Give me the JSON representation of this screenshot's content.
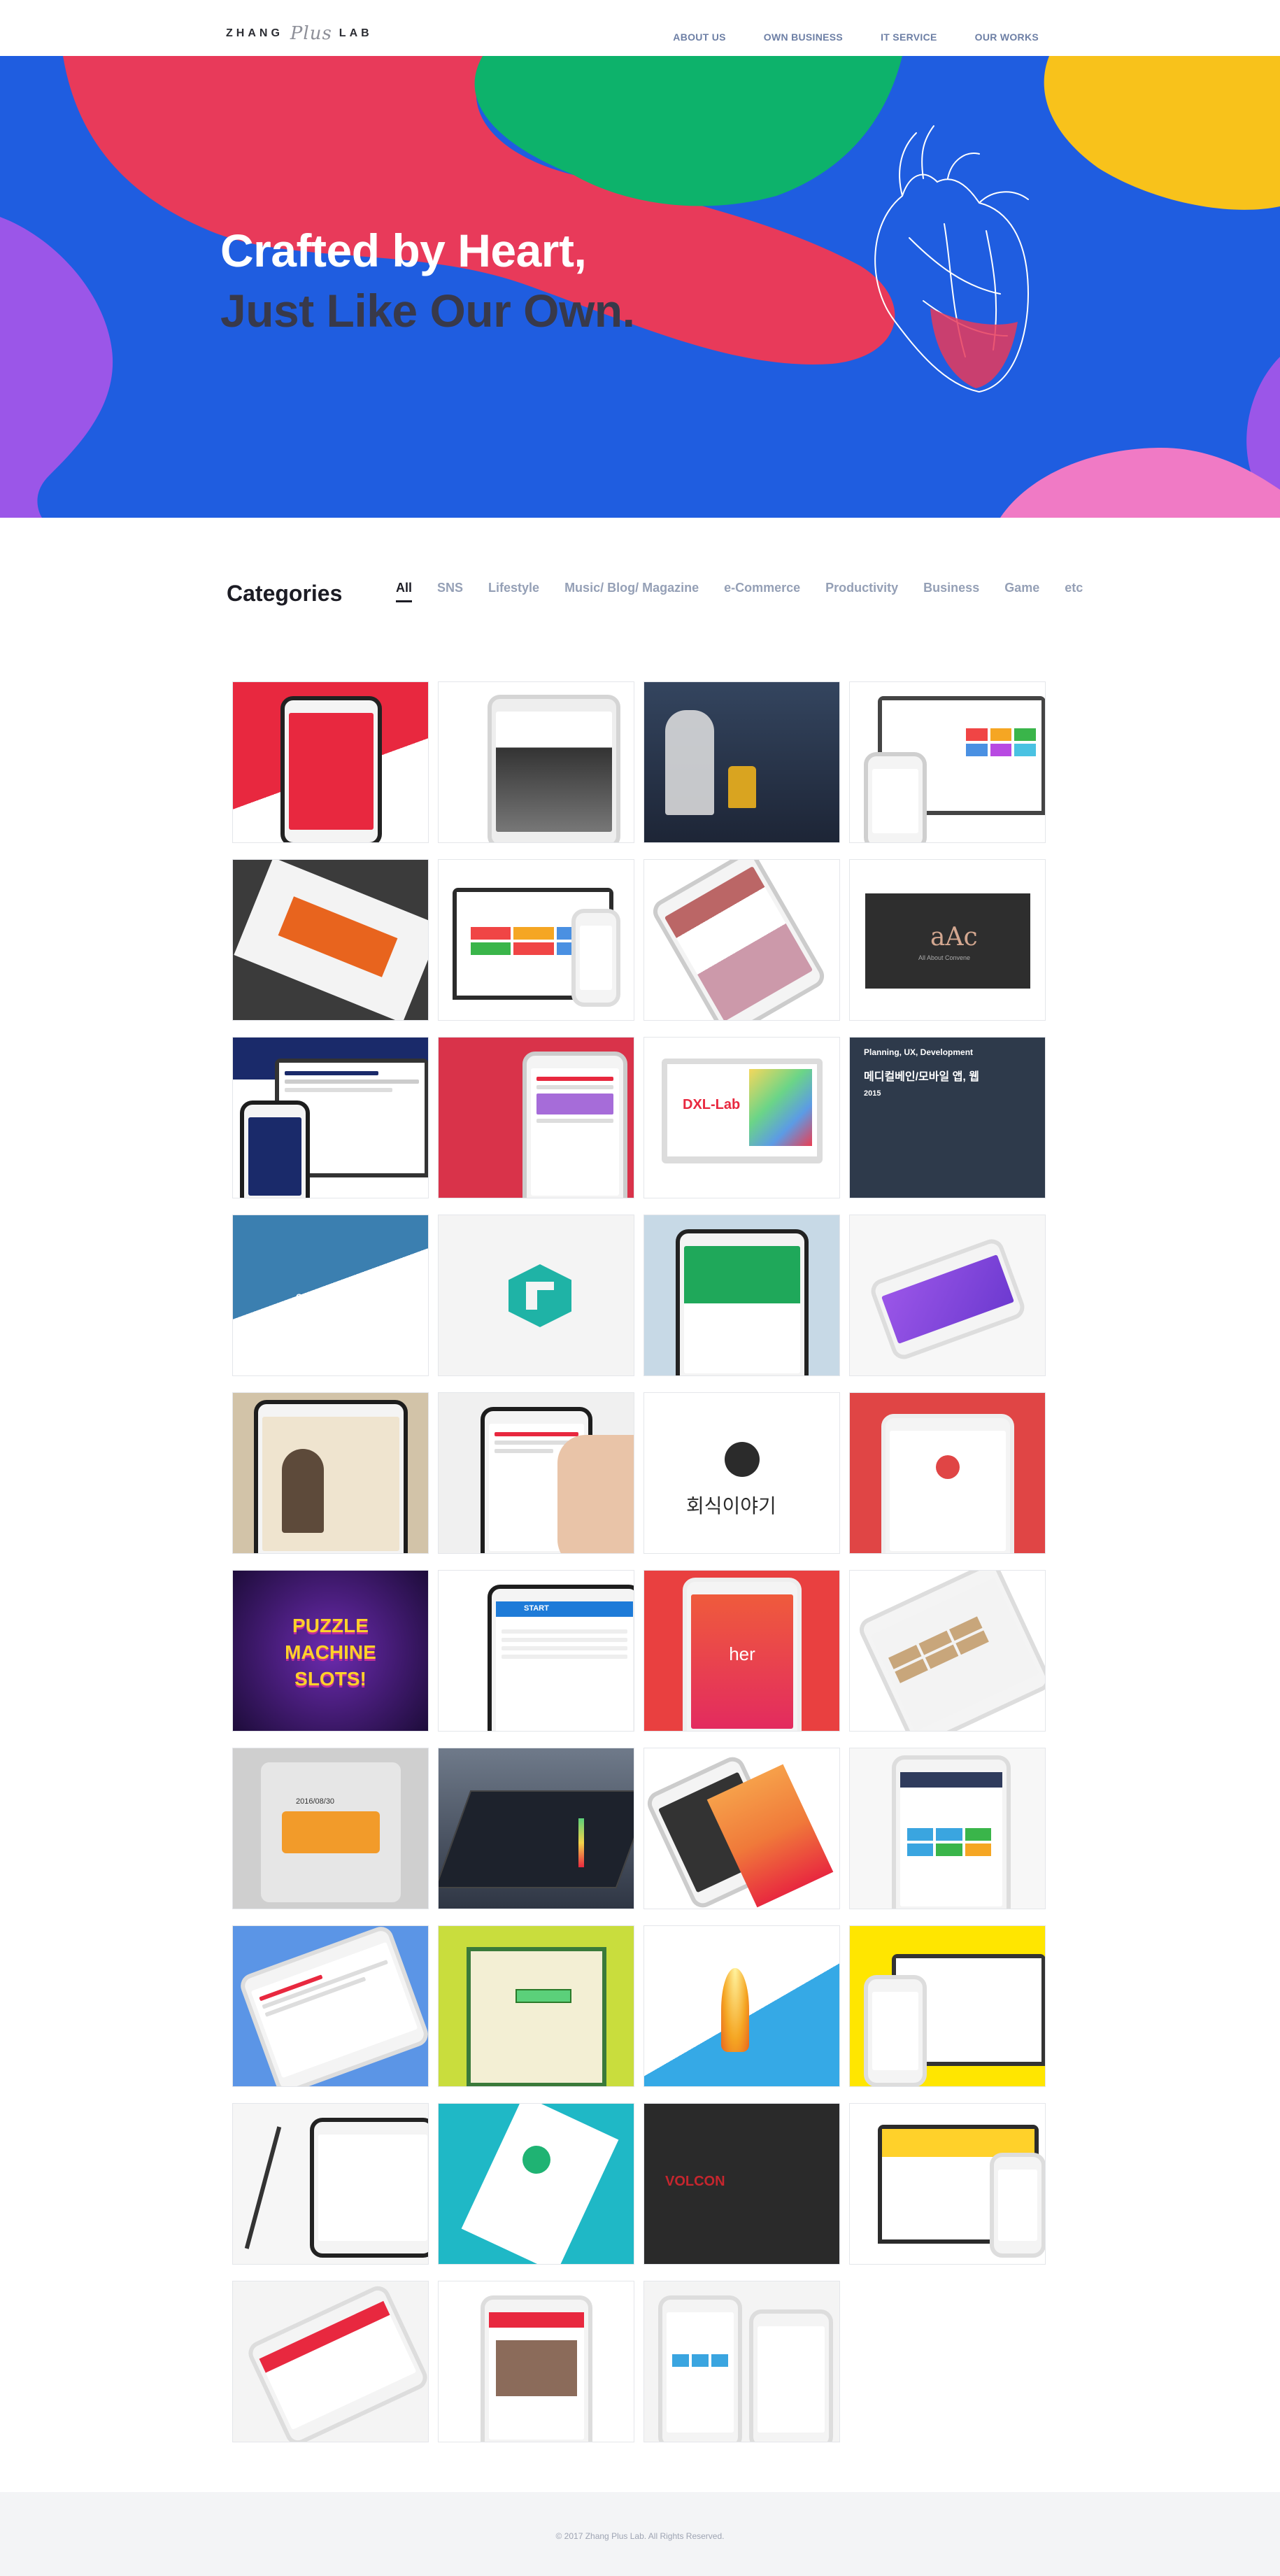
{
  "header": {
    "logo_word_left": "ZHANG",
    "logo_script": "Plus",
    "logo_word_right": "LAB",
    "nav": [
      "ABOUT US",
      "OWN BUSINESS",
      "IT SERVICE",
      "OUR WORKS"
    ]
  },
  "hero": {
    "line1": "Crafted by Heart,",
    "line2": "Just Like Our Own.",
    "illustration": "heart-illustration"
  },
  "categories": {
    "title": "Categories",
    "tabs": [
      "All",
      "SNS",
      "Lifestyle",
      "Music/ Blog/ Magazine",
      "e-Commerce",
      "Productivity",
      "Business",
      "Game",
      "etc"
    ],
    "active_tab": "All"
  },
  "portfolio": {
    "tile_12": {
      "line1": "Planning, UX, Development",
      "line2": "메디컬베인/모바일 앱, 웹",
      "line3": "2015"
    },
    "tile_16_text": "Core Value.",
    "tile_9_text": "DXL-Lab",
    "tile_24_text": "회식이야기",
    "tile_25_text": "PUZZLE MACHINE SLOTS!",
    "tile_27_text": "her",
    "tile_26_text": "START",
    "tile_29_text": "2016/08/30",
    "tile_38_text": "VOLCON",
    "tile_8_text": "All About Convene"
  },
  "footer": {
    "copyright": "© 2017 Zhang Plus Lab. All Rights Reserved."
  },
  "colors": {
    "hero_blue": "#1f5de0",
    "hero_red": "#e83a5a",
    "hero_green": "#0db26b",
    "hero_yellow": "#f8c21b",
    "hero_purple": "#9b56e8",
    "hero_pink": "#f07ac5",
    "nav_text": "#6d7fa5"
  }
}
